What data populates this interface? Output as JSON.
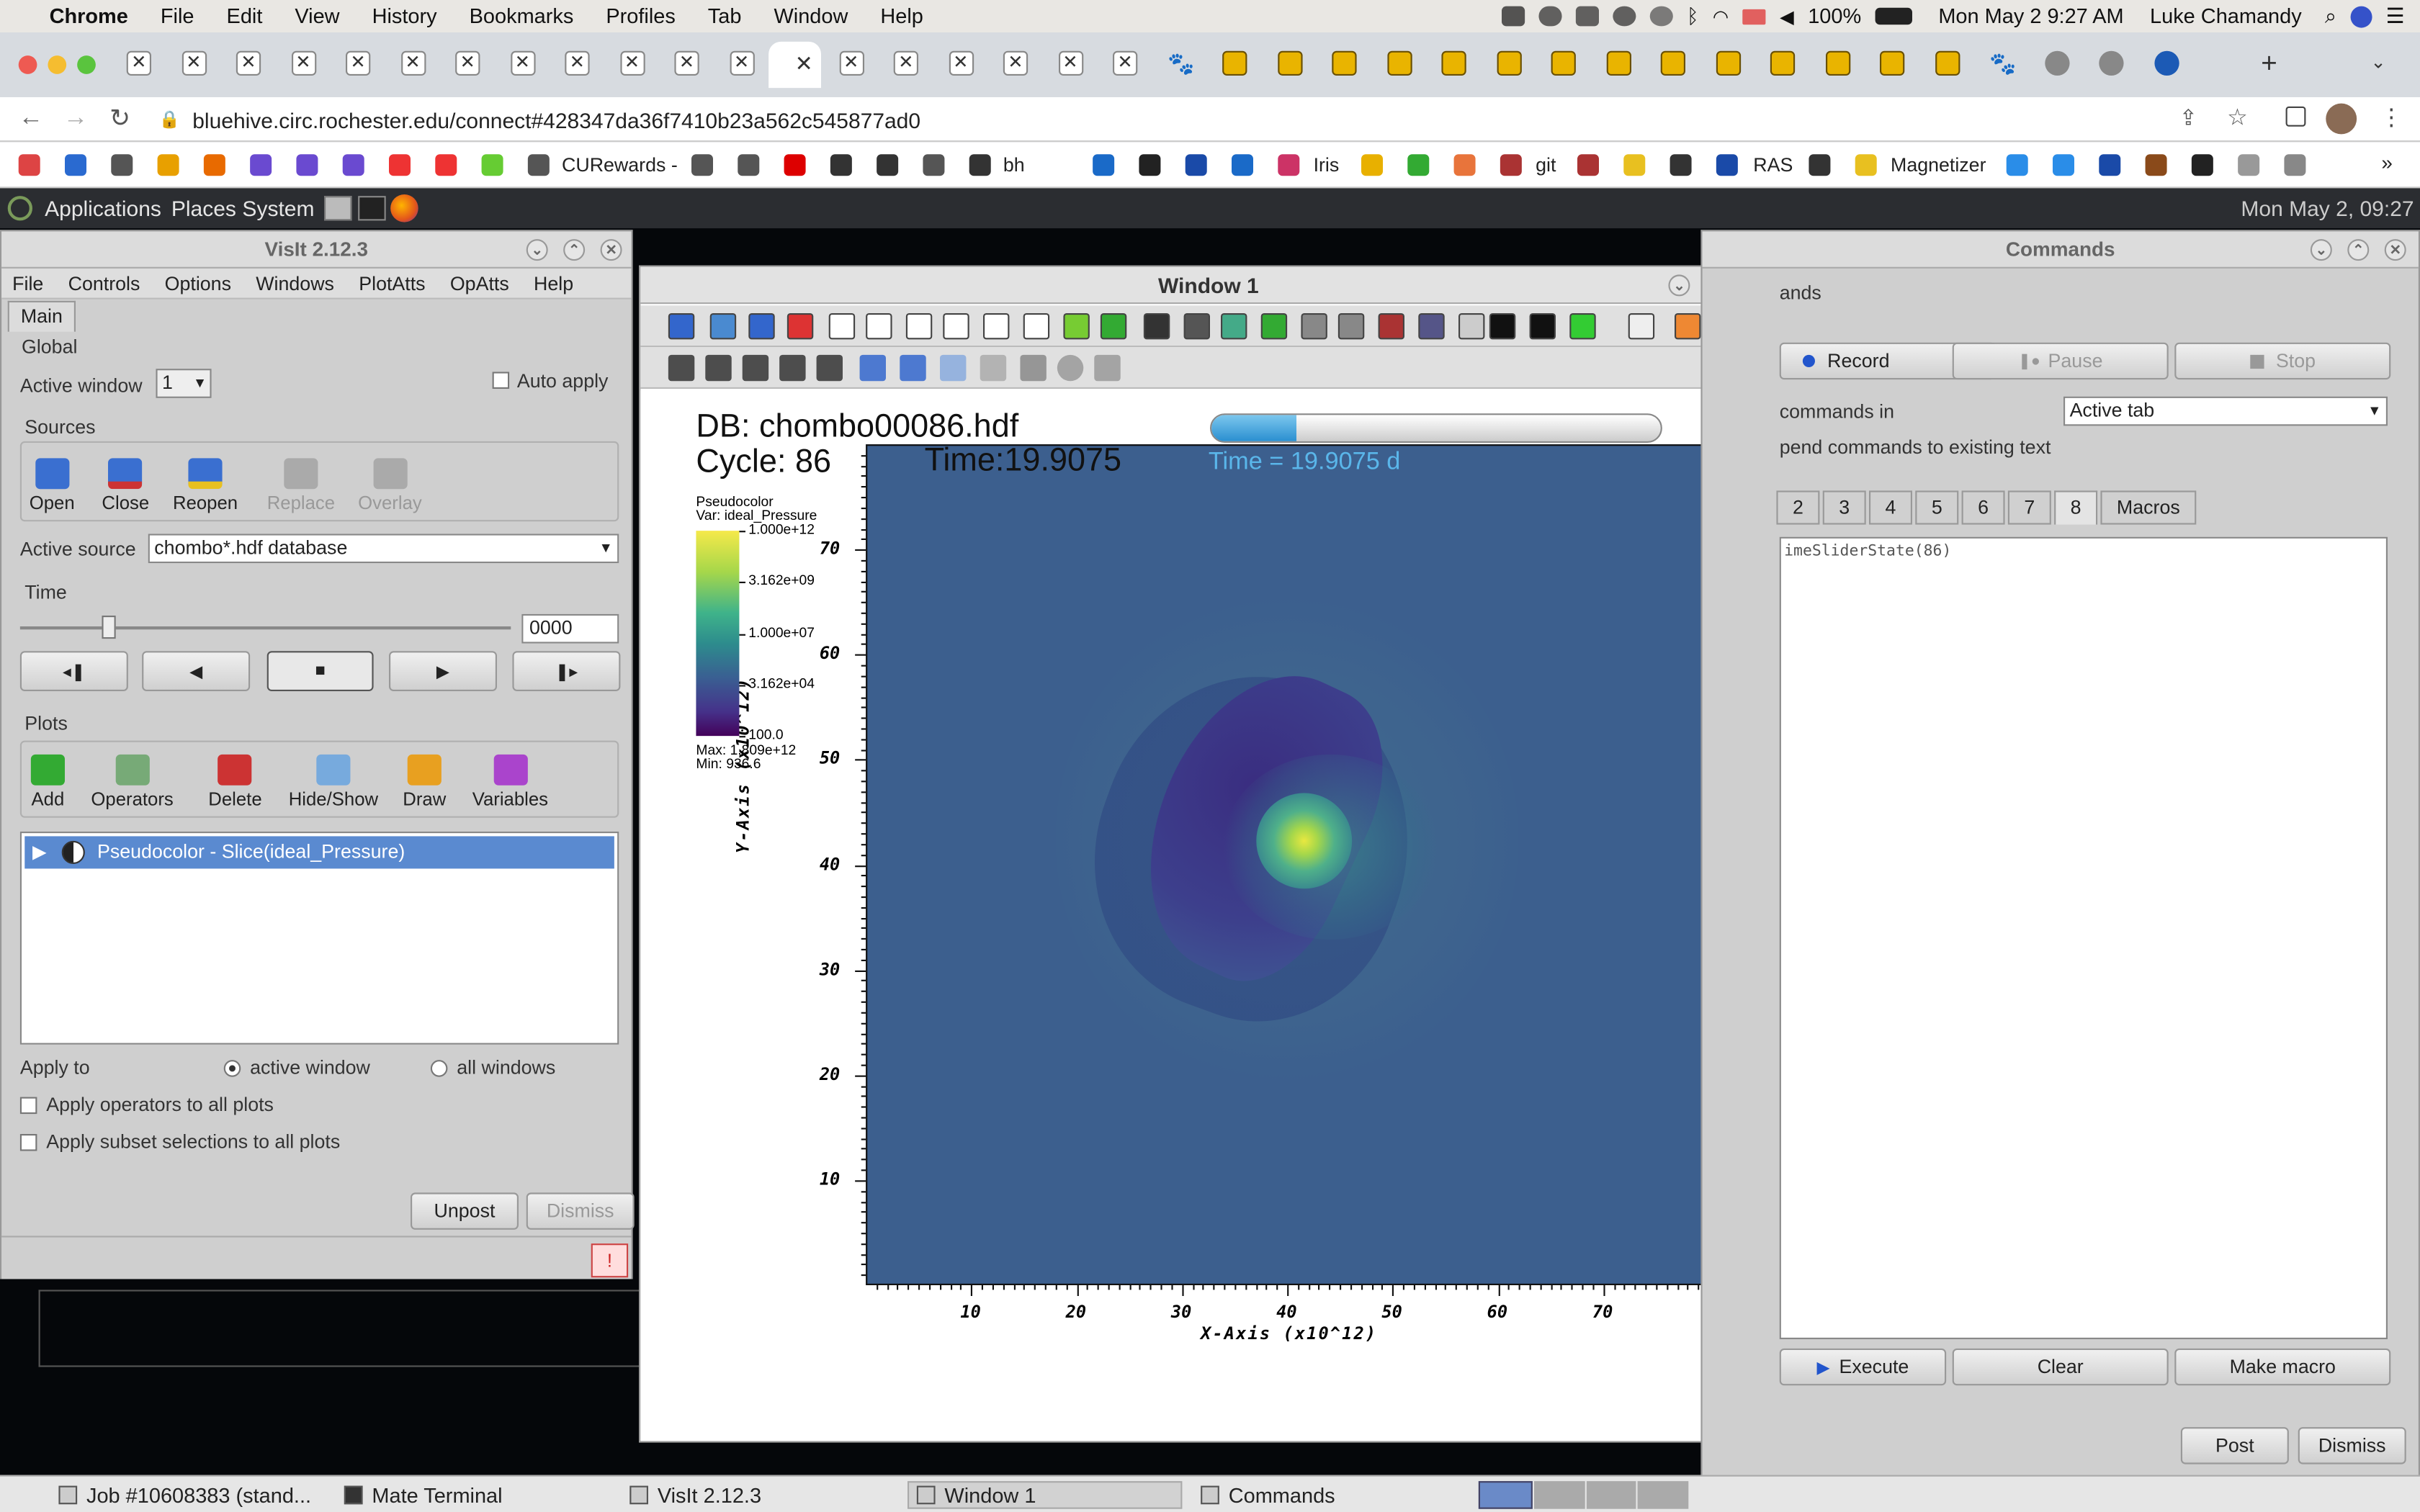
{
  "macos_menubar": {
    "app": "Chrome",
    "items": [
      "File",
      "Edit",
      "View",
      "History",
      "Bookmarks",
      "Profiles",
      "Tab",
      "Window",
      "Help"
    ],
    "battery": "100%",
    "datetime": "Mon May 2  9:27 AM",
    "user": "Luke Chamandy"
  },
  "browser": {
    "url": "bluehive.circ.rochester.edu/connect#428347da36f7410b23a562c545877ad0",
    "bookmarks": [
      "CURewards -",
      "bh",
      "Iris",
      "git",
      "RAS",
      "Magnetizer"
    ]
  },
  "mate_panel": {
    "menus": [
      "Applications",
      "Places",
      "System"
    ],
    "clock": "Mon May  2, 09:27"
  },
  "visit_main": {
    "title": "VisIt 2.12.3",
    "menu": [
      "File",
      "Controls",
      "Options",
      "Windows",
      "PlotAtts",
      "OpAtts",
      "Help"
    ],
    "tab": "Main",
    "global_label": "Global",
    "active_window_label": "Active window",
    "active_window_value": "1",
    "auto_apply_label": "Auto apply",
    "sources_label": "Sources",
    "source_buttons": [
      "Open",
      "Close",
      "Reopen",
      "Replace",
      "Overlay"
    ],
    "active_source_label": "Active source",
    "active_source_value": "chombo*.hdf database",
    "time_label": "Time",
    "time_value": "0000",
    "time_slider_fraction": 0.18,
    "plots_label": "Plots",
    "plot_buttons": [
      "Add",
      "Operators",
      "Delete",
      "Hide/Show",
      "Draw",
      "Variables"
    ],
    "plot_item": "Pseudocolor - Slice(ideal_Pressure)",
    "apply_to_label": "Apply to",
    "apply_active": "active window",
    "apply_all": "all windows",
    "apply_operators": "Apply operators to all plots",
    "apply_subset": "Apply subset selections to all plots",
    "unpost": "Unpost",
    "dismiss": "Dismiss"
  },
  "window1": {
    "title": "Window 1",
    "db": "DB: chombo00086.hdf",
    "cycle": "Cycle: 86",
    "time_text": "Time:19.9075",
    "time_label_blue": "Time = 19.9075 d",
    "progress_fraction": 0.19,
    "legend": {
      "title": "Pseudocolor",
      "var": "Var: ideal_Pressure",
      "ticks": [
        "1.000e+12",
        "3.162e+09",
        "1.000e+07",
        "3.162e+04",
        "100.0"
      ],
      "max": "Max:  1.809e+12",
      "min": "Min:  936.6"
    },
    "xlabel": "X-Axis  (x10^12)",
    "ylabel": "Y-Axis  (x10^12)",
    "xticks": [
      "10",
      "20",
      "30",
      "40",
      "50",
      "60",
      "70"
    ],
    "yticks": [
      "70",
      "60",
      "50",
      "40",
      "30",
      "20",
      "10"
    ],
    "background_color": "#3c5f8e"
  },
  "commands": {
    "title": "Commands",
    "group_label": "ands",
    "record": "Record",
    "pause": "Pause",
    "stop": "Stop",
    "commands_in_label": "commands in",
    "commands_in_value": "Active tab",
    "append_label": "pend commands to existing text",
    "tabs": [
      "2",
      "3",
      "4",
      "5",
      "6",
      "7",
      "8",
      "Macros"
    ],
    "code": "imeSliderState(86)",
    "execute": "Execute",
    "clear": "Clear",
    "make_macro": "Make macro",
    "post": "Post",
    "dismiss": "Dismiss"
  },
  "taskbar": {
    "items": [
      "Job #10608383 (stand...",
      "Mate Terminal",
      "VisIt 2.12.3",
      "Window 1",
      "Commands"
    ]
  }
}
